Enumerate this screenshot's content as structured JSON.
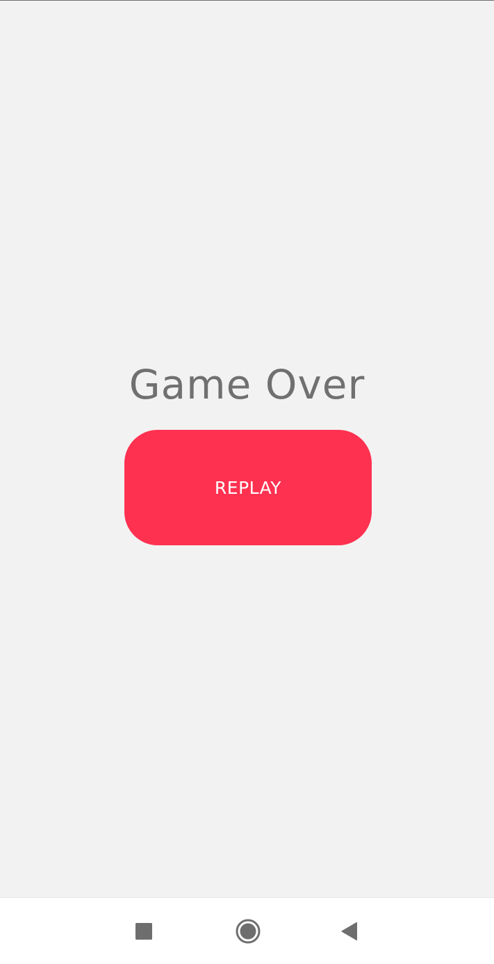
{
  "game": {
    "title": "Game Over",
    "replay_label": "REPLAY"
  },
  "colors": {
    "background": "#f2f2f2",
    "title_text": "#707070",
    "replay_button": "#ff3150",
    "replay_text": "#ffffff",
    "navbar_background": "#ffffff",
    "navbar_icons": "#6e6e6e"
  },
  "navbar": {
    "icons": [
      "recents-icon",
      "home-icon",
      "back-icon"
    ]
  }
}
